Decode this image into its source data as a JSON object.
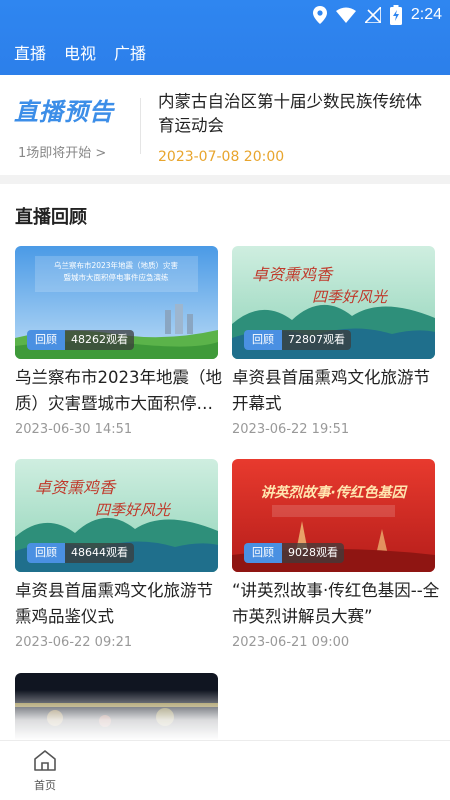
{
  "status_bar": {
    "time": "2:24",
    "icons": [
      "location-icon",
      "wifi-icon",
      "signal-icon",
      "battery-icon"
    ]
  },
  "tabs": [
    "直播",
    "电视",
    "广播"
  ],
  "live_preview": {
    "logo_text": "直播预告",
    "count_text": "1场即将开始 >",
    "event_title": "内蒙古自治区第十届少数民族传统体育运动会",
    "event_time": "2023-07-08 20:00"
  },
  "section_title": "直播回顾",
  "cards": [
    {
      "title": "乌兰察布市2023年地震（地质）灾害暨城市大面积停电事件应急演练",
      "date": "2023-06-30 14:51",
      "tag": "回顾",
      "views": "48262观看",
      "thumb_title": "乌兰察布市2023年地震（地质）灾害暨城市大面积停电事件应急演练"
    },
    {
      "title": "卓资县首届熏鸡文化旅游节开幕式",
      "date": "2023-06-22 19:51",
      "tag": "回顾",
      "views": "72807观看",
      "thumb_title": "卓资熏鸡香 四季好风光"
    },
    {
      "title": "卓资县首届熏鸡文化旅游节 熏鸡品鉴仪式",
      "date": "2023-06-22 09:21",
      "tag": "回顾",
      "views": "48644观看",
      "thumb_title": "卓资熏鸡香 四季好风光"
    },
    {
      "title": "“讲英烈故事·传红色基因--全市英烈讲解员大赛”",
      "date": "2023-06-21 09:00",
      "tag": "回顾",
      "views": "9028观看",
      "thumb_title": "讲英烈故事·传红色基因"
    }
  ],
  "bottom_nav": {
    "home_label": "首页"
  },
  "colors": {
    "primary": "#2c7fea",
    "accent_time": "#e8a52d",
    "badge": "#4a90e2"
  }
}
